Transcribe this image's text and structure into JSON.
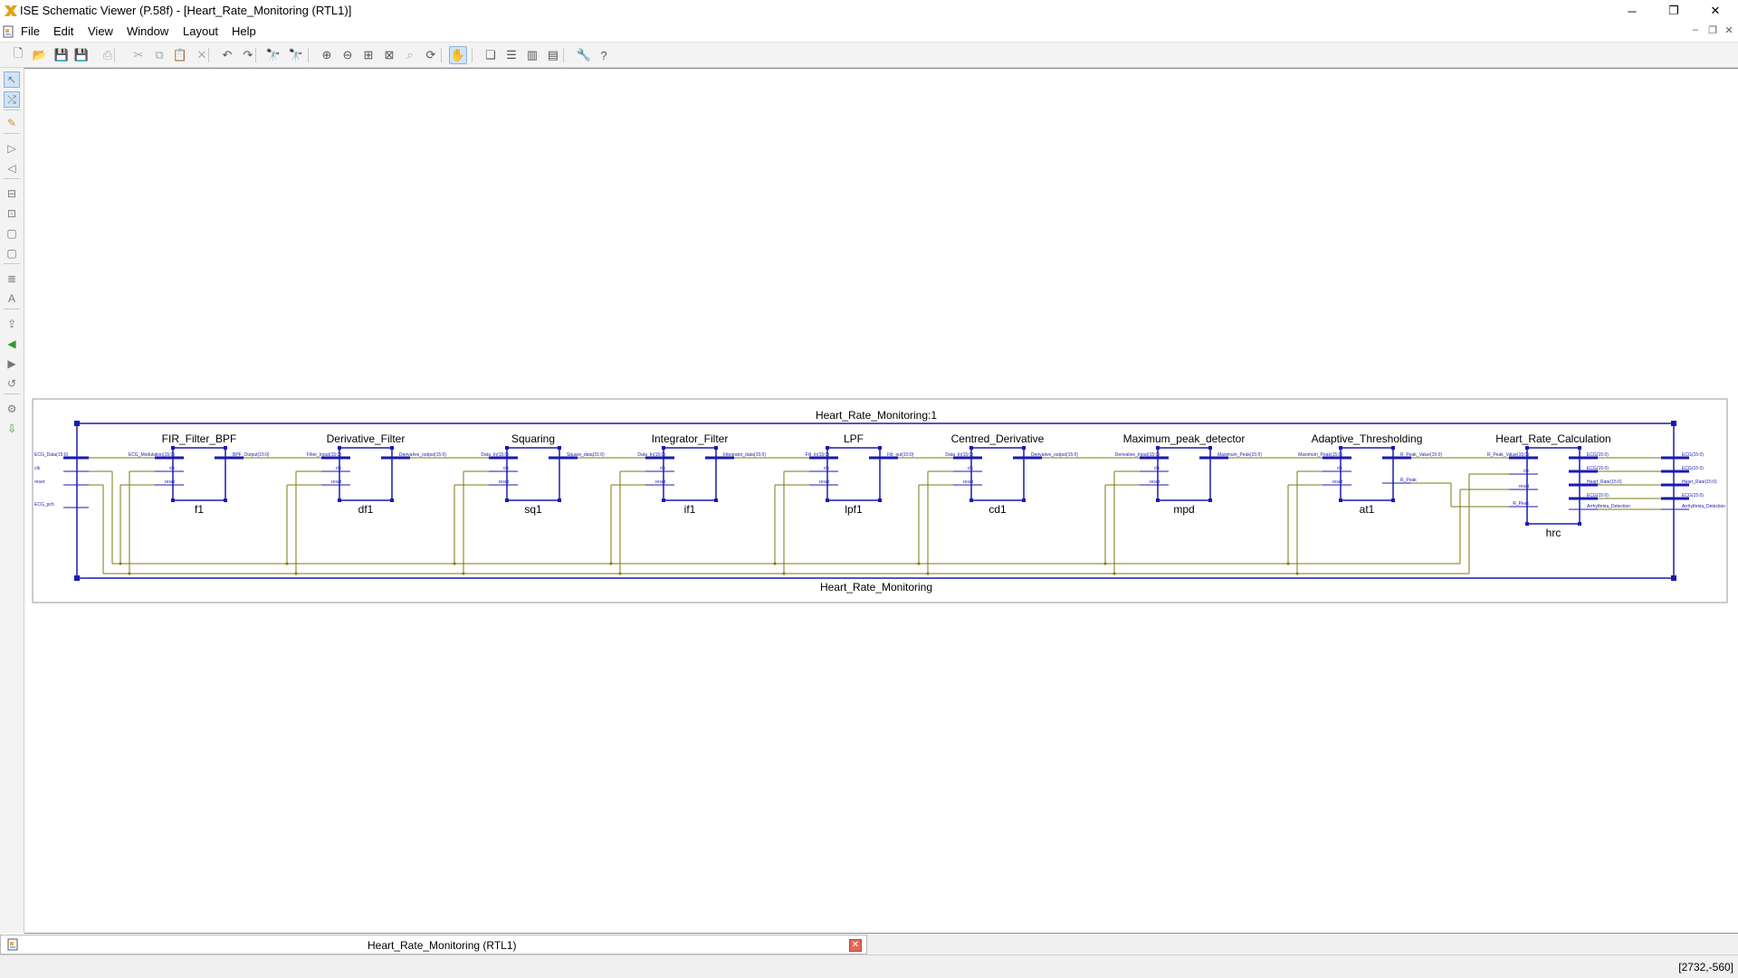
{
  "window": {
    "title": "ISE Schematic Viewer (P.58f) - [Heart_Rate_Monitoring (RTL1)]",
    "controls": {
      "minimize": "─",
      "maximize": "❐",
      "close": "✕"
    }
  },
  "menubar": {
    "items": [
      "File",
      "Edit",
      "View",
      "Window",
      "Layout",
      "Help"
    ],
    "mdi_controls": {
      "minimize": "–",
      "restore": "❐",
      "close": "✕"
    }
  },
  "toolbar": {
    "buttons": [
      {
        "name": "new-icon",
        "glyph": "🗋"
      },
      {
        "name": "open-icon",
        "glyph": "📂"
      },
      {
        "name": "save-icon",
        "glyph": "💾"
      },
      {
        "name": "save-all-icon",
        "glyph": "💾"
      },
      {
        "name": "print-icon",
        "glyph": "⎙"
      },
      {
        "name": "cut-icon",
        "glyph": "✂"
      },
      {
        "name": "copy-icon",
        "glyph": "⧉"
      },
      {
        "name": "paste-icon",
        "glyph": "📋"
      },
      {
        "name": "delete-icon",
        "glyph": "✕"
      },
      {
        "name": "undo-icon",
        "glyph": "↶"
      },
      {
        "name": "redo-icon",
        "glyph": "↷"
      },
      {
        "name": "find-icon",
        "glyph": "🔭"
      },
      {
        "name": "find-next-icon",
        "glyph": "🔭"
      },
      {
        "name": "zoom-in-icon",
        "glyph": "⊕"
      },
      {
        "name": "zoom-out-icon",
        "glyph": "⊖"
      },
      {
        "name": "zoom-fit-icon",
        "glyph": "⊞"
      },
      {
        "name": "zoom-selection-icon",
        "glyph": "⊠"
      },
      {
        "name": "zoom-area-icon",
        "glyph": "⌕"
      },
      {
        "name": "refresh-icon",
        "glyph": "⟳"
      },
      {
        "name": "pan-icon",
        "glyph": "✋"
      },
      {
        "name": "cascade-icon",
        "glyph": "❏"
      },
      {
        "name": "tile-horizontal-icon",
        "glyph": "☰"
      },
      {
        "name": "tile-vertical-icon",
        "glyph": "▥"
      },
      {
        "name": "arrange-icon",
        "glyph": "▤"
      },
      {
        "name": "tools-icon",
        "glyph": "🔧"
      },
      {
        "name": "help-context-icon",
        "glyph": "?"
      }
    ]
  },
  "lefttools": [
    {
      "name": "select-tool-icon",
      "glyph": "↖"
    },
    {
      "name": "route-tool-icon",
      "glyph": "⤭"
    },
    {
      "name": "highlight-tool-icon",
      "glyph": "✎"
    },
    {
      "name": "push-into-icon",
      "glyph": "▷"
    },
    {
      "name": "pop-out-icon",
      "glyph": "◁"
    },
    {
      "name": "hierarchy-icon",
      "glyph": "⊟"
    },
    {
      "name": "instance-icon",
      "glyph": "⊡"
    },
    {
      "name": "port-icon",
      "glyph": "▢"
    },
    {
      "name": "net-icon",
      "glyph": "▢"
    },
    {
      "name": "properties-icon",
      "glyph": "≣"
    },
    {
      "name": "text-icon",
      "glyph": "A"
    },
    {
      "name": "upload-icon",
      "glyph": "⇪"
    },
    {
      "name": "back-icon",
      "glyph": "◀"
    },
    {
      "name": "forward-icon",
      "glyph": "▶"
    },
    {
      "name": "history-icon",
      "glyph": "↺"
    },
    {
      "name": "options-icon",
      "glyph": "⚙"
    },
    {
      "name": "export-icon",
      "glyph": "⇩"
    }
  ],
  "schematic": {
    "outer_label_top": "Heart_Rate_Monitoring:1",
    "outer_label_bottom": "Heart_Rate_Monitoring",
    "wire_color": "#7a7a10",
    "block_color": "#1a1ab0",
    "top_inputs": [
      "ECG_Data(15:0)",
      "clk",
      "reset",
      "ECG_pch"
    ],
    "top_outputs": [
      "ECG(15:0)",
      "ECG(15:0)",
      "Heart_Rate(15:0)",
      "ECG(15:0)",
      "Arrhythmia_Detection"
    ],
    "blocks": [
      {
        "type": "FIR_Filter_BPF",
        "inst": "f1",
        "in": [
          "ECG_Modulation(15:0)",
          "clk",
          "reset"
        ],
        "out": [
          "BPF_Output(15:0)"
        ]
      },
      {
        "type": "Derivative_Filter",
        "inst": "df1",
        "in": [
          "Filter_Input(15:0)",
          "clk",
          "reset"
        ],
        "out": [
          "Derivative_output(15:0)"
        ]
      },
      {
        "type": "Squaring",
        "inst": "sq1",
        "in": [
          "Data_In(15:0)",
          "clk",
          "reset"
        ],
        "out": [
          "Square_data(31:0)"
        ]
      },
      {
        "type": "Integrator_Filter",
        "inst": "if1",
        "in": [
          "Data_In(15:0)",
          "clk",
          "reset"
        ],
        "out": [
          "Integrator_data(15:0)"
        ]
      },
      {
        "type": "LPF",
        "inst": "lpf1",
        "in": [
          "Filt_in(15:0)",
          "clk",
          "reset"
        ],
        "out": [
          "Filt_out(15:0)"
        ]
      },
      {
        "type": "Centred_Derivative",
        "inst": "cd1",
        "in": [
          "Data_In(15:0)",
          "clk",
          "reset"
        ],
        "out": [
          "Derivative_output(15:0)"
        ]
      },
      {
        "type": "Maximum_peak_detector",
        "inst": "mpd",
        "in": [
          "Derivative_Input(15:0)",
          "clk",
          "reset"
        ],
        "out": [
          "Maximum_Peak(15:0)"
        ]
      },
      {
        "type": "Adaptive_Thresholding",
        "inst": "at1",
        "in": [
          "Maximum_Peak(15:0)",
          "clk",
          "reset"
        ],
        "out": [
          "R_Peak_Value(15:0)",
          "R_Peak"
        ]
      },
      {
        "type": "Heart_Rate_Calculation",
        "inst": "hrc",
        "in": [
          "R_Peak_Value(15:0)",
          "clk",
          "reset",
          "R_Peak"
        ],
        "out": [
          "ECG(15:0)",
          "ECG(15:0)",
          "Heart_Rate(15:0)",
          "ECG(15:0)",
          "Arrhythmia_Detection"
        ]
      }
    ]
  },
  "tab": {
    "label": "Heart_Rate_Monitoring (RTL1)",
    "close": "✕"
  },
  "status": {
    "coords": "[2732,-560]"
  }
}
